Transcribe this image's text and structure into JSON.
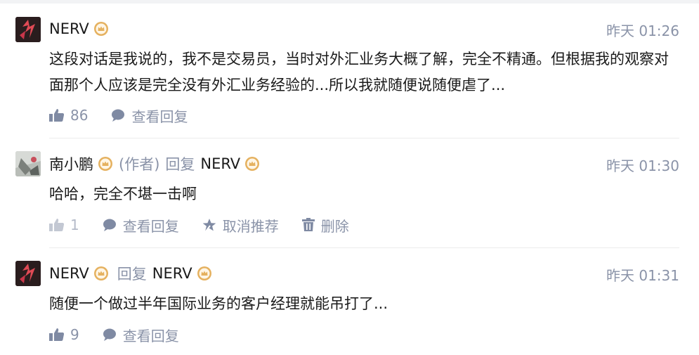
{
  "comments": [
    {
      "author": "NERV",
      "time": "昨天 01:26",
      "text": "这段对话是我说的，我不是交易员，当时对外汇业务大概了解，完全不精通。但根据我的观察对面那个人应该是完全没有外汇业务经验的...所以我就随便说随便虐了...",
      "likes": "86",
      "view_replies": "查看回复"
    },
    {
      "author": "南小鹏",
      "author_tag": "(作者)",
      "reply_word": "回复",
      "reply_to": "NERV",
      "time": "昨天 01:30",
      "text": "哈哈，完全不堪一击啊",
      "likes": "1",
      "view_replies": "查看回复",
      "unrecommend": "取消推荐",
      "delete": "删除"
    },
    {
      "author": "NERV",
      "reply_word": "回复",
      "reply_to": "NERV",
      "time": "昨天 01:31",
      "text": "随便一个做过半年国际业务的客户经理就能吊打了...",
      "likes": "9",
      "view_replies": "查看回复"
    }
  ],
  "colors": {
    "muted": "#8a93a8",
    "badge_gold": "#e5b15f",
    "divider": "#ececec"
  },
  "icons": [
    "thumbs-up-icon",
    "speech-bubble-icon",
    "star-icon",
    "trash-icon",
    "crown-badge-icon"
  ]
}
